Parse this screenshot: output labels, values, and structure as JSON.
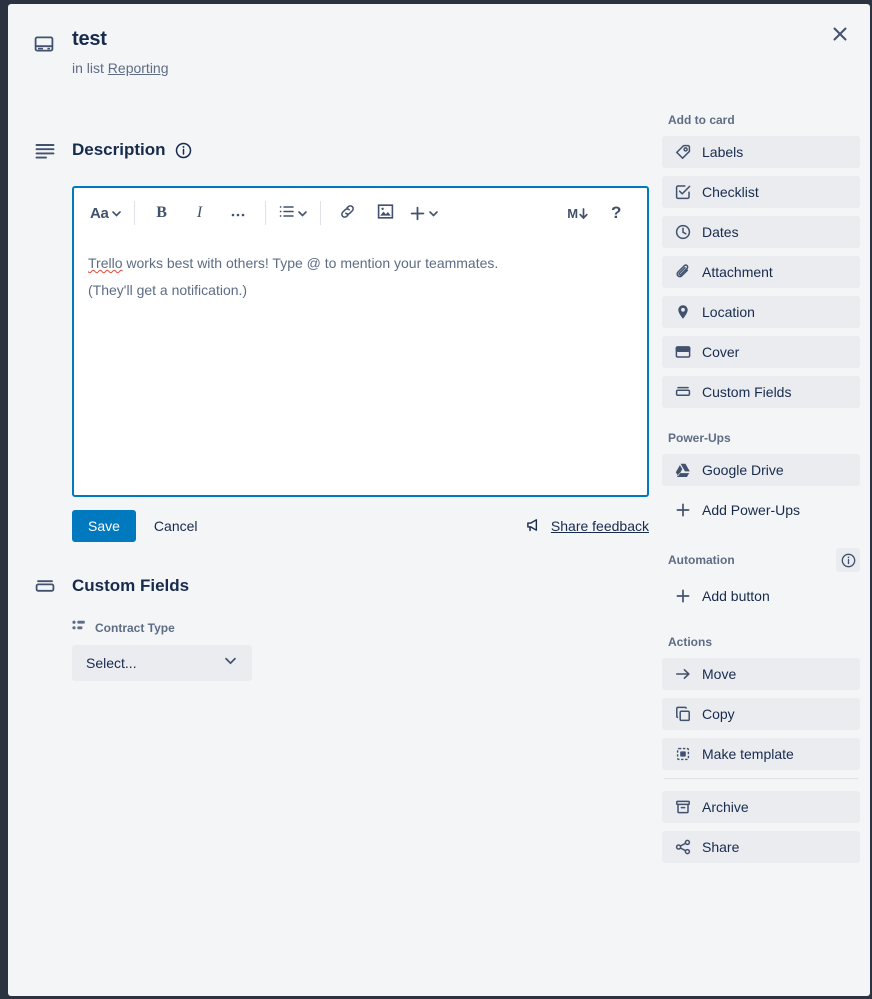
{
  "window": {
    "close_label": "Close",
    "accent_color": "#0079bf",
    "modal_bg": "#f4f5f7",
    "board_bg": "#2c3340"
  },
  "header": {
    "icon": "card-icon",
    "title": "test",
    "in_list_prefix": "in list",
    "list_name": "Reporting"
  },
  "description": {
    "icon": "description-lines-icon",
    "heading": "Description",
    "info_icon": "info-icon",
    "toolbar": {
      "font_style": "Aa",
      "bold": "B",
      "italic": "I",
      "more": "…",
      "list": "list-icon",
      "link": "link-icon",
      "image": "image-icon",
      "plus": "+",
      "markdown": "M",
      "help": "?"
    },
    "placeholder_line1_word": "Trello",
    "placeholder_line1_rest": " works best with others! Type @ to mention your teammates.",
    "placeholder_line2": "(They'll get a notification.)",
    "save_label": "Save",
    "cancel_label": "Cancel",
    "share_feedback_label": "Share feedback"
  },
  "custom_fields": {
    "icon": "custom-fields-icon",
    "heading": "Custom Fields",
    "field_label": "Contract Type",
    "field_icon": "dropdown-list-icon",
    "select_value": "Select..."
  },
  "sidebar": {
    "add_to_card": {
      "heading": "Add to card",
      "items": [
        {
          "label": "Labels",
          "icon": "label-tag-icon"
        },
        {
          "label": "Checklist",
          "icon": "checklist-icon"
        },
        {
          "label": "Dates",
          "icon": "clock-icon"
        },
        {
          "label": "Attachment",
          "icon": "paperclip-icon"
        },
        {
          "label": "Location",
          "icon": "location-pin-icon"
        },
        {
          "label": "Cover",
          "icon": "cover-icon"
        },
        {
          "label": "Custom Fields",
          "icon": "custom-fields-icon"
        }
      ]
    },
    "power_ups": {
      "heading": "Power-Ups",
      "items": [
        {
          "label": "Google Drive",
          "icon": "google-drive-icon",
          "plain": false
        },
        {
          "label": "Add Power-Ups",
          "icon": "plus-icon",
          "plain": true
        }
      ]
    },
    "automation": {
      "heading": "Automation",
      "info_icon": "info-icon",
      "items": [
        {
          "label": "Add button",
          "icon": "plus-icon",
          "plain": true
        }
      ]
    },
    "actions": {
      "heading": "Actions",
      "items": [
        {
          "label": "Move",
          "icon": "arrow-right-icon"
        },
        {
          "label": "Copy",
          "icon": "copy-icon"
        },
        {
          "label": "Make template",
          "icon": "template-icon"
        }
      ],
      "items_after_divider": [
        {
          "label": "Archive",
          "icon": "archive-icon"
        },
        {
          "label": "Share",
          "icon": "share-icon"
        }
      ]
    }
  }
}
